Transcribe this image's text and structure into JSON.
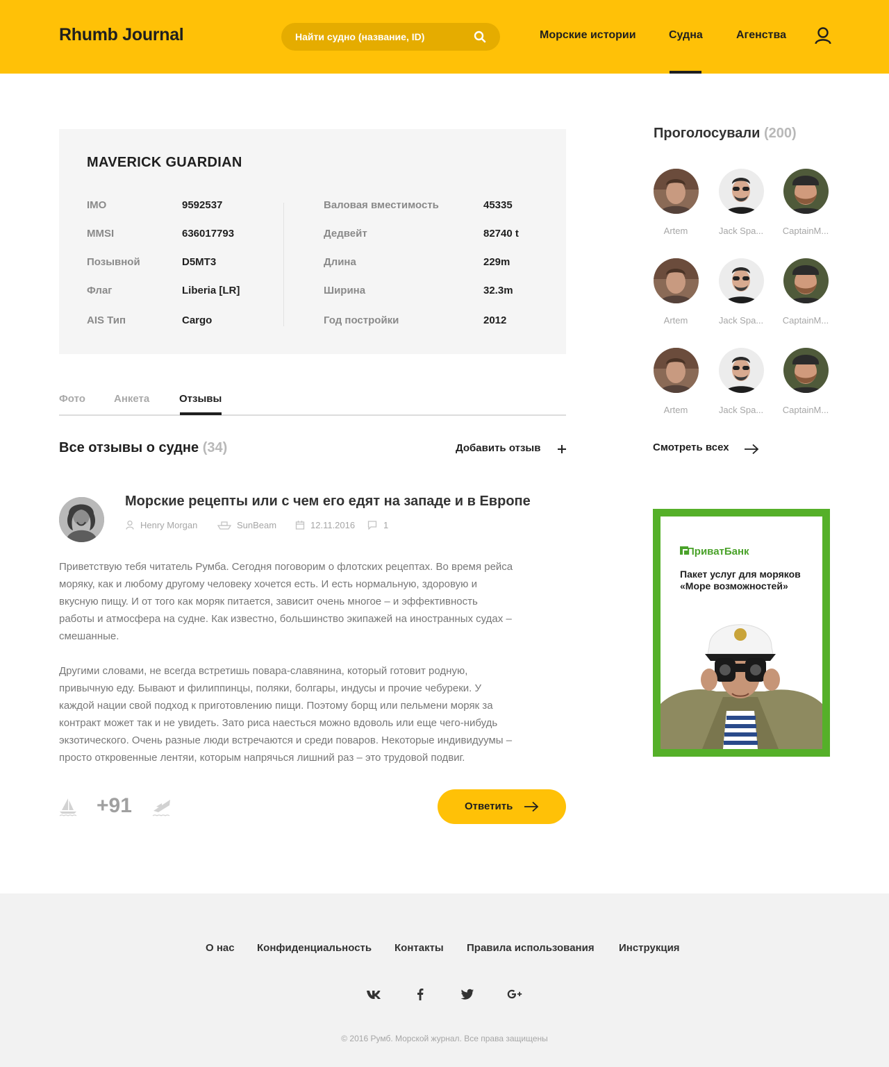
{
  "header": {
    "logo": "Rhumb Journal",
    "search_placeholder": "Найти судно (название, ID)",
    "nav": [
      "Морские истории",
      "Судна",
      "Агенства"
    ],
    "active_nav": "Судна"
  },
  "vessel": {
    "name": "MAVERICK GUARDIAN",
    "specs_left": [
      {
        "label": "IMO",
        "value": "9592537"
      },
      {
        "label": "MMSI",
        "value": "636017793"
      },
      {
        "label": "Позывной",
        "value": "D5MT3"
      },
      {
        "label": "Флаг",
        "value": "Liberia [LR]"
      },
      {
        "label": "AIS Тип",
        "value": "Cargo"
      }
    ],
    "specs_right": [
      {
        "label": "Валовая вместимость",
        "value": "45335"
      },
      {
        "label": "Дедвейт",
        "value": "82740 t"
      },
      {
        "label": "Длина",
        "value": "229m"
      },
      {
        "label": "Ширина",
        "value": "32.3m"
      },
      {
        "label": "Год постройки",
        "value": "2012"
      }
    ]
  },
  "tabs": [
    "Фото",
    "Анкета",
    "Отзывы"
  ],
  "active_tab": "Отзывы",
  "reviews": {
    "title": "Все отзывы о судне",
    "count": "(34)",
    "add_label": "Добавить отзыв"
  },
  "post": {
    "title": "Морские рецепты или с чем его едят на западе и в Европе",
    "author": "Henry Morgan",
    "vessel": "SunBeam",
    "date": "12.11.2016",
    "comments": "1",
    "paragraphs": [
      [
        "Приветствую тебя читатель Румба. Сегодня поговорим о флотских рецептах. Во время рейса",
        "моряку, как и любому другому человеку хочется есть. И есть нормальную, здоровую и",
        "вкусную пищу. И от того как моряк питается, зависит очень многое – и эффективность",
        "работы и атмосфера на судне. Как известно, большинство экипажей на иностранных судах –",
        "смешанные."
      ],
      [
        "Другими словами, не всегда встретишь повара-славянина, который готовит родную,",
        "привычную еду. Бывают и филиппинцы, поляки, болгары, индусы и прочие чебуреки. У",
        "каждой нации свой подход к приготовлению пищи. Поэтому борщ или пельмени моряк за",
        "контракт может так и не увидеть. Зато риса наесться можно вдоволь или еще чего-нибудь",
        "экзотического. Очень разные люди встречаются и среди поваров. Некоторые индивидуумы –",
        "просто откровенные лентяи, которым напрячься лишний раз – это трудовой подвиг."
      ]
    ],
    "score": "+91",
    "reply_label": "Ответить"
  },
  "voters": {
    "title": "Проголосували",
    "count": "(200)",
    "names": [
      "Artem",
      "Jack Spa...",
      "CaptainM...",
      "Artem",
      "Jack Spa...",
      "CaptainM...",
      "Artem",
      "Jack Spa...",
      "CaptainM..."
    ],
    "see_all": "Смотреть всех"
  },
  "ad": {
    "brand": "ПриватБанк",
    "headline": [
      "Пакет услуг для моряков",
      "«Море возможностей»"
    ]
  },
  "footer": {
    "links": [
      "О нас",
      "Конфиденциальность",
      "Контакты",
      "Правила использования",
      "Инструкция"
    ],
    "social": [
      "vk-icon",
      "facebook-icon",
      "twitter-icon",
      "google-plus-icon"
    ],
    "copyright": "© 2016 Румб. Морской журнал. Все права защищены"
  },
  "colors": {
    "brand_yellow": "#ffc107",
    "search_bg": "#e5ac00",
    "ad_green": "#55b029"
  }
}
